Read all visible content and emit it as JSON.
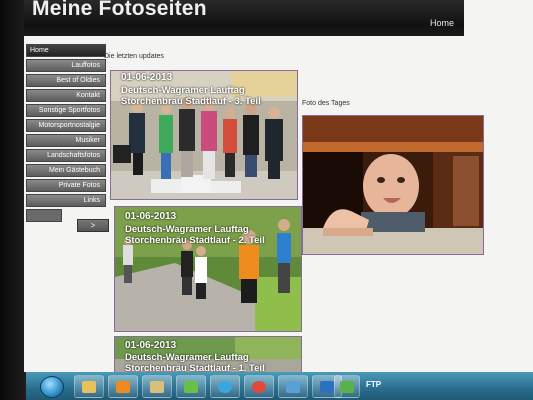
{
  "header": {
    "site_title": "Meine Fotoseiten",
    "home_link": "Home"
  },
  "sidebar": {
    "items": [
      {
        "label": "Home",
        "active": true
      },
      {
        "label": "Lauffotos"
      },
      {
        "label": "Best of Oldies"
      },
      {
        "label": "Kontakt"
      },
      {
        "label": "Sonstige Sportfotos"
      },
      {
        "label": "Motorsportnostalgie"
      },
      {
        "label": "Musiker"
      },
      {
        "label": "Landschaftsfotos"
      },
      {
        "label": "Mein Gästebuch"
      },
      {
        "label": "Private Fotos"
      },
      {
        "label": "Links"
      }
    ],
    "next_label": ">"
  },
  "main": {
    "updates_label": "Die letzten updates",
    "photo_of_day_label": "Foto des Tages",
    "updates": [
      {
        "date": "01-06-2013",
        "title": "Deutsch-Wagramer Lauftag Storchenbräu Stadtlauf - 3. Teil"
      },
      {
        "date": "01-06-2013",
        "title": "Deutsch-Wagramer Lauftag Storchenbräu Stadtlauf - 2. Teil"
      },
      {
        "date": "01-06-2013",
        "title": "Deutsch-Wagramer Lauftag Storchenbräu Stadtlauf - 1. Teil"
      }
    ]
  },
  "taskbar": {
    "buttons": [
      "explorer-icon",
      "media-player-icon",
      "folder-icon",
      "image-viewer-icon",
      "browser-icon",
      "chrome-icon",
      "network-icon",
      "document-icon",
      "presentation-icon"
    ],
    "ftp_label": "FTP"
  }
}
